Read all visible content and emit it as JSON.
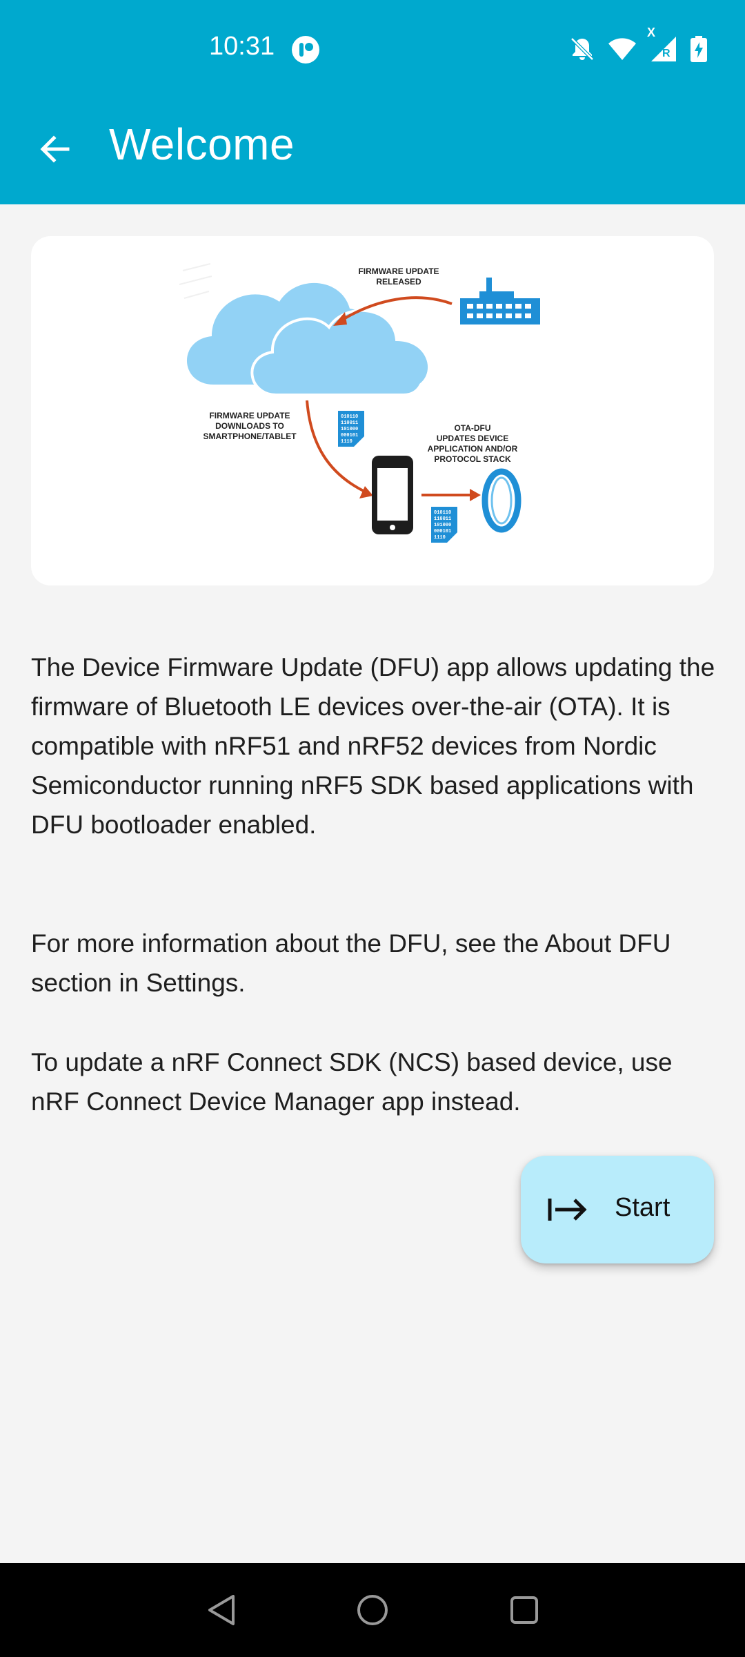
{
  "status_bar": {
    "time": "10:31",
    "icons": [
      "ticker-notification-icon",
      "bell-off-icon",
      "wifi-icon",
      "cellular-roaming-icon",
      "battery-charging-icon"
    ],
    "roaming_marker_top": "X",
    "roaming_marker_bottom": "R"
  },
  "app_bar": {
    "title": "Welcome",
    "back_icon": "arrow-back-icon"
  },
  "hero": {
    "label_released": [
      "FIRMWARE UPDATE",
      "RELEASED"
    ],
    "label_downloads": [
      "FIRMWARE UPDATE",
      "DOWNLOADS TO",
      "SMARTPHONE/TABLET"
    ],
    "label_ota": [
      "OTA-DFU",
      "UPDATES DEVICE",
      "APPLICATION AND/OR",
      "PROTOCOL STACK"
    ],
    "binary_lines": [
      "010110",
      "110011",
      "101000",
      "000101",
      "1110"
    ]
  },
  "content": {
    "paragraph1": "The Device Firmware Update (DFU) app allows updating the firmware of Bluetooth LE devices over-the-air (OTA). It is compatible with nRF51 and nRF52 devices from Nordic Semiconductor running nRF5 SDK based applications with DFU bootloader enabled.",
    "paragraph2": "For more information about the DFU, see the About DFU section in Settings.",
    "paragraph3": "To update a nRF Connect SDK (NCS) based device, use nRF Connect Device Manager app instead."
  },
  "fab": {
    "label": "Start",
    "icon": "arrow-right-to-line-icon"
  },
  "nav_bar": {
    "items": [
      "back-triangle-icon",
      "home-circle-icon",
      "recents-square-icon"
    ]
  },
  "colors": {
    "primary": "#00a9ce",
    "fab_bg": "#b8ecfb",
    "background": "#f4f4f4",
    "cloud": "#92d2f5",
    "arrow": "#d04a1e",
    "device_blue": "#1f8fd6"
  }
}
